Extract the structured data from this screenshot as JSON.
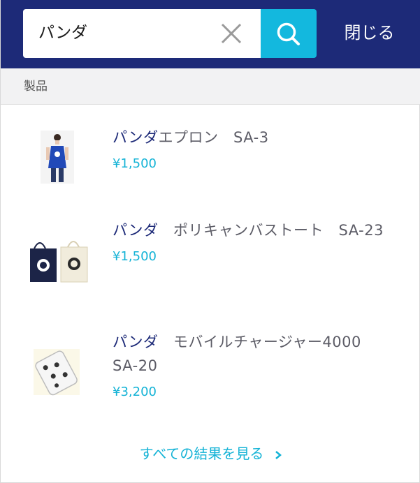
{
  "search": {
    "query": "パンダ",
    "close_label": "閉じる"
  },
  "category": {
    "label": "製品"
  },
  "products": [
    {
      "name_highlight": "パンダ",
      "name_rest": "エプロン　SA-3",
      "price": "¥1,500"
    },
    {
      "name_highlight": "パンダ",
      "name_rest": "　ポリキャンバストート　SA-23",
      "price": "¥1,500"
    },
    {
      "name_highlight": "パンダ",
      "name_rest": "　モバイルチャージャー4000　SA-20",
      "price": "¥3,200"
    }
  ],
  "see_all": {
    "label": "すべての結果を見る"
  },
  "colors": {
    "header_bg": "#1d2a78",
    "accent": "#13b8de",
    "category_bg": "#f2f2f3"
  },
  "icons": {
    "clear": "close-x-icon",
    "search": "magnifier-icon",
    "see_all": "chevron-right-icon"
  }
}
